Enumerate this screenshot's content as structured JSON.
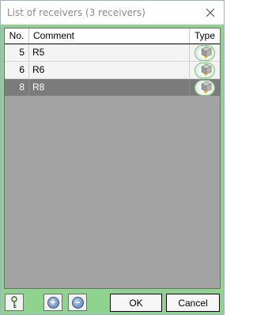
{
  "window": {
    "title": "List of receivers (3 receivers)"
  },
  "table": {
    "headers": {
      "no": "No.",
      "comment": "Comment",
      "type": "Type"
    },
    "rows": [
      {
        "no": "5",
        "comment": "R5",
        "type_icon": "receiver-icon",
        "selected": false
      },
      {
        "no": "6",
        "comment": "R6",
        "type_icon": "receiver-icon",
        "selected": false
      },
      {
        "no": "8",
        "comment": "R8",
        "type_icon": "receiver-icon",
        "selected": true
      }
    ]
  },
  "buttons": {
    "ok": "OK",
    "cancel": "Cancel"
  },
  "icons": {
    "close": "close-icon",
    "key": "key-icon",
    "add": "plus-circle-icon",
    "remove": "minus-circle-icon"
  },
  "colors": {
    "frame_green": "#8fd38f",
    "list_bg": "#a3a3a3",
    "selected_row": "#7b7b7b"
  }
}
